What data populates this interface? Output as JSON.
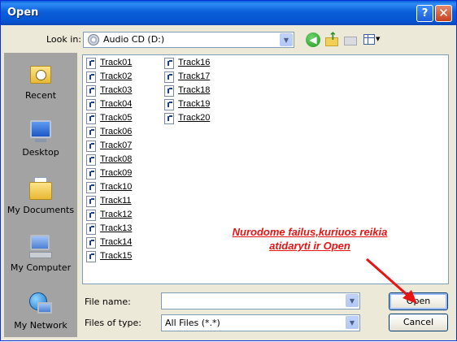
{
  "window": {
    "title": "Open",
    "help_label": "?",
    "close_label": "✕"
  },
  "toolbar": {
    "lookin_label": "Look in:",
    "lookin_value": "Audio CD (D:)",
    "icons": [
      "back-icon",
      "up-folder-icon",
      "new-folder-icon",
      "views-icon"
    ]
  },
  "places": [
    {
      "label": "Recent",
      "icon": "recent-icon"
    },
    {
      "label": "Desktop",
      "icon": "desktop-icon"
    },
    {
      "label": "My Documents",
      "icon": "my-documents-icon"
    },
    {
      "label": "My Computer",
      "icon": "my-computer-icon"
    },
    {
      "label": "My Network",
      "icon": "my-network-icon"
    }
  ],
  "files": [
    "Track01",
    "Track02",
    "Track03",
    "Track04",
    "Track05",
    "Track06",
    "Track07",
    "Track08",
    "Track09",
    "Track10",
    "Track11",
    "Track12",
    "Track13",
    "Track14",
    "Track15",
    "Track16",
    "Track17",
    "Track18",
    "Track19",
    "Track20"
  ],
  "annotation": {
    "line1": "Nurodome failus,kuriuos reikia",
    "line2": "atidaryti ir Open",
    "color": "#e81414"
  },
  "form": {
    "filename_label": "File name:",
    "filename_value": "",
    "filetype_label": "Files of type:",
    "filetype_value": "All Files (*.*)"
  },
  "buttons": {
    "open_label": "Open",
    "cancel_label": "Cancel"
  },
  "colors": {
    "titlebar": "#0a5fd8",
    "places_bg": "#a3a3a3",
    "dialog_bg": "#ece9d8"
  }
}
